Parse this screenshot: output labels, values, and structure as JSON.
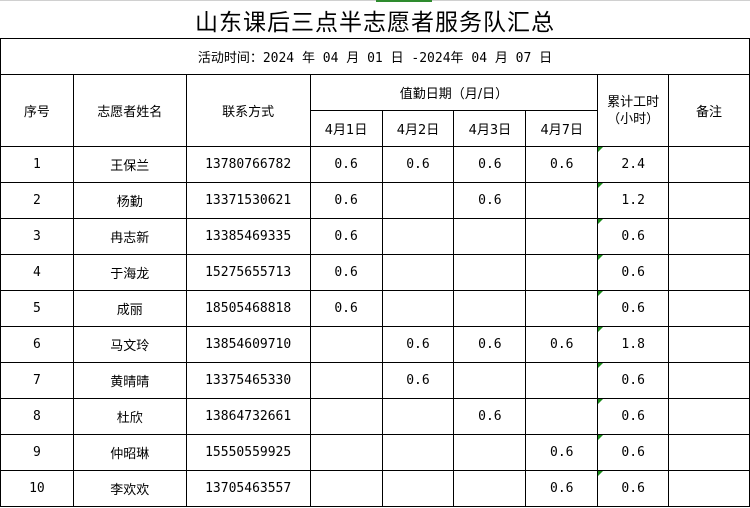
{
  "title": "山东课后三点半志愿者服务队汇总",
  "period": "活动时间：2024 年 04 月 01 日  -2024年 04 月 07 日",
  "headers": {
    "seq": "序号",
    "name": "志愿者姓名",
    "contact": "联系方式",
    "duty_dates": "值勤日期（月/日）",
    "total_hours": "累计工时（小时）",
    "notes": "备注",
    "dates": [
      "4月1日",
      "4月2日",
      "4月3日",
      "4月7日"
    ]
  },
  "rows": [
    {
      "seq": "1",
      "name": "王保兰",
      "phone": "13780766782",
      "d1": "0.6",
      "d2": "0.6",
      "d3": "0.6",
      "d4": "0.6",
      "total": "2.4",
      "note": ""
    },
    {
      "seq": "2",
      "name": "杨勤",
      "phone": "13371530621",
      "d1": "0.6",
      "d2": "",
      "d3": "0.6",
      "d4": "",
      "total": "1.2",
      "note": ""
    },
    {
      "seq": "3",
      "name": "冉志新",
      "phone": "13385469335",
      "d1": "0.6",
      "d2": "",
      "d3": "",
      "d4": "",
      "total": "0.6",
      "note": ""
    },
    {
      "seq": "4",
      "name": "于海龙",
      "phone": "15275655713",
      "d1": "0.6",
      "d2": "",
      "d3": "",
      "d4": "",
      "total": "0.6",
      "note": ""
    },
    {
      "seq": "5",
      "name": "成丽",
      "phone": "18505468818",
      "d1": "0.6",
      "d2": "",
      "d3": "",
      "d4": "",
      "total": "0.6",
      "note": ""
    },
    {
      "seq": "6",
      "name": "马文玲",
      "phone": "13854609710",
      "d1": "",
      "d2": "0.6",
      "d3": "0.6",
      "d4": "0.6",
      "total": "1.8",
      "note": ""
    },
    {
      "seq": "7",
      "name": "黄晴晴",
      "phone": "13375465330",
      "d1": "",
      "d2": "0.6",
      "d3": "",
      "d4": "",
      "total": "0.6",
      "note": ""
    },
    {
      "seq": "8",
      "name": "杜欣",
      "phone": "13864732661",
      "d1": "",
      "d2": "",
      "d3": "0.6",
      "d4": "",
      "total": "0.6",
      "note": ""
    },
    {
      "seq": "9",
      "name": "仲昭琳",
      "phone": "15550559925",
      "d1": "",
      "d2": "",
      "d3": "",
      "d4": "0.6",
      "total": "0.6",
      "note": ""
    },
    {
      "seq": "10",
      "name": "李欢欢",
      "phone": "13705463557",
      "d1": "",
      "d2": "",
      "d3": "",
      "d4": "0.6",
      "total": "0.6",
      "note": ""
    }
  ]
}
